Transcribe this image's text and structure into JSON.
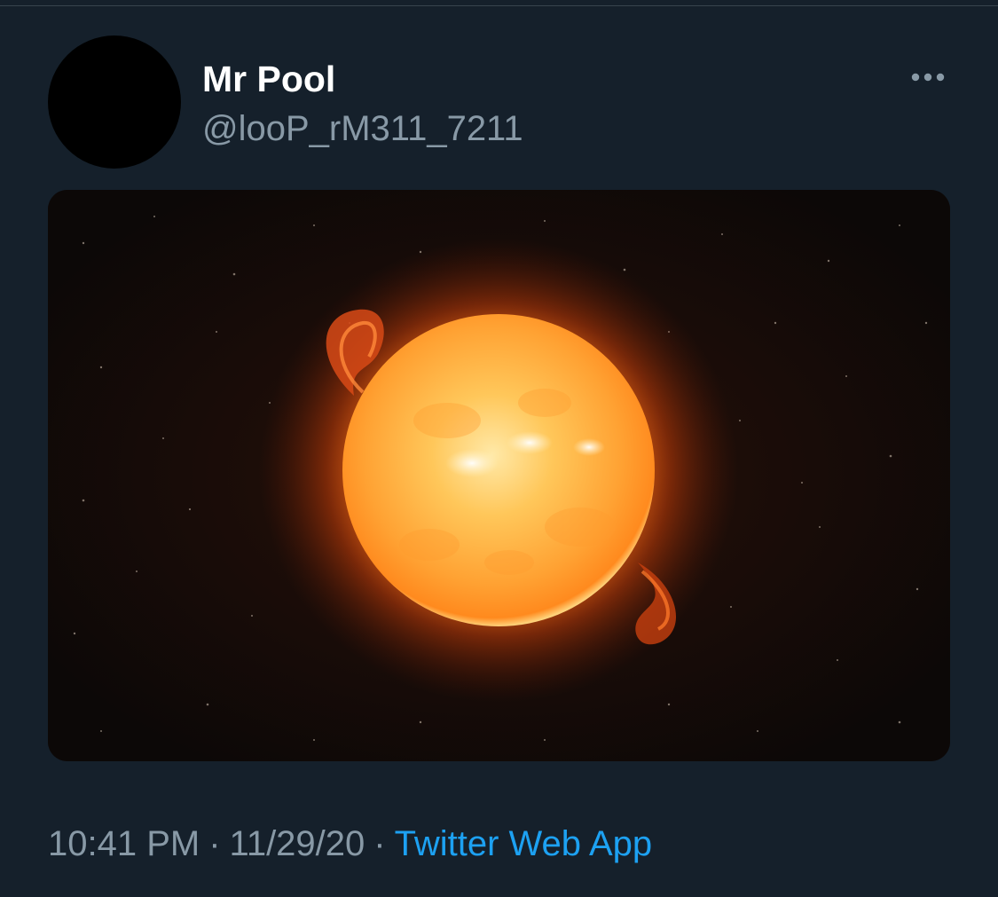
{
  "tweet": {
    "author": {
      "display_name": "Mr Pool",
      "handle": "@looP_rM311_7211"
    },
    "media": {
      "icon": "sun-star-image"
    },
    "meta": {
      "time": "10:41 PM",
      "separator": "·",
      "date": "11/29/20",
      "source": "Twitter Web App"
    },
    "more_icon": "more-horizontal-icon"
  },
  "colors": {
    "background": "#15202b",
    "text_primary": "#ffffff",
    "text_secondary": "#8899a6",
    "link": "#1da1f2"
  }
}
